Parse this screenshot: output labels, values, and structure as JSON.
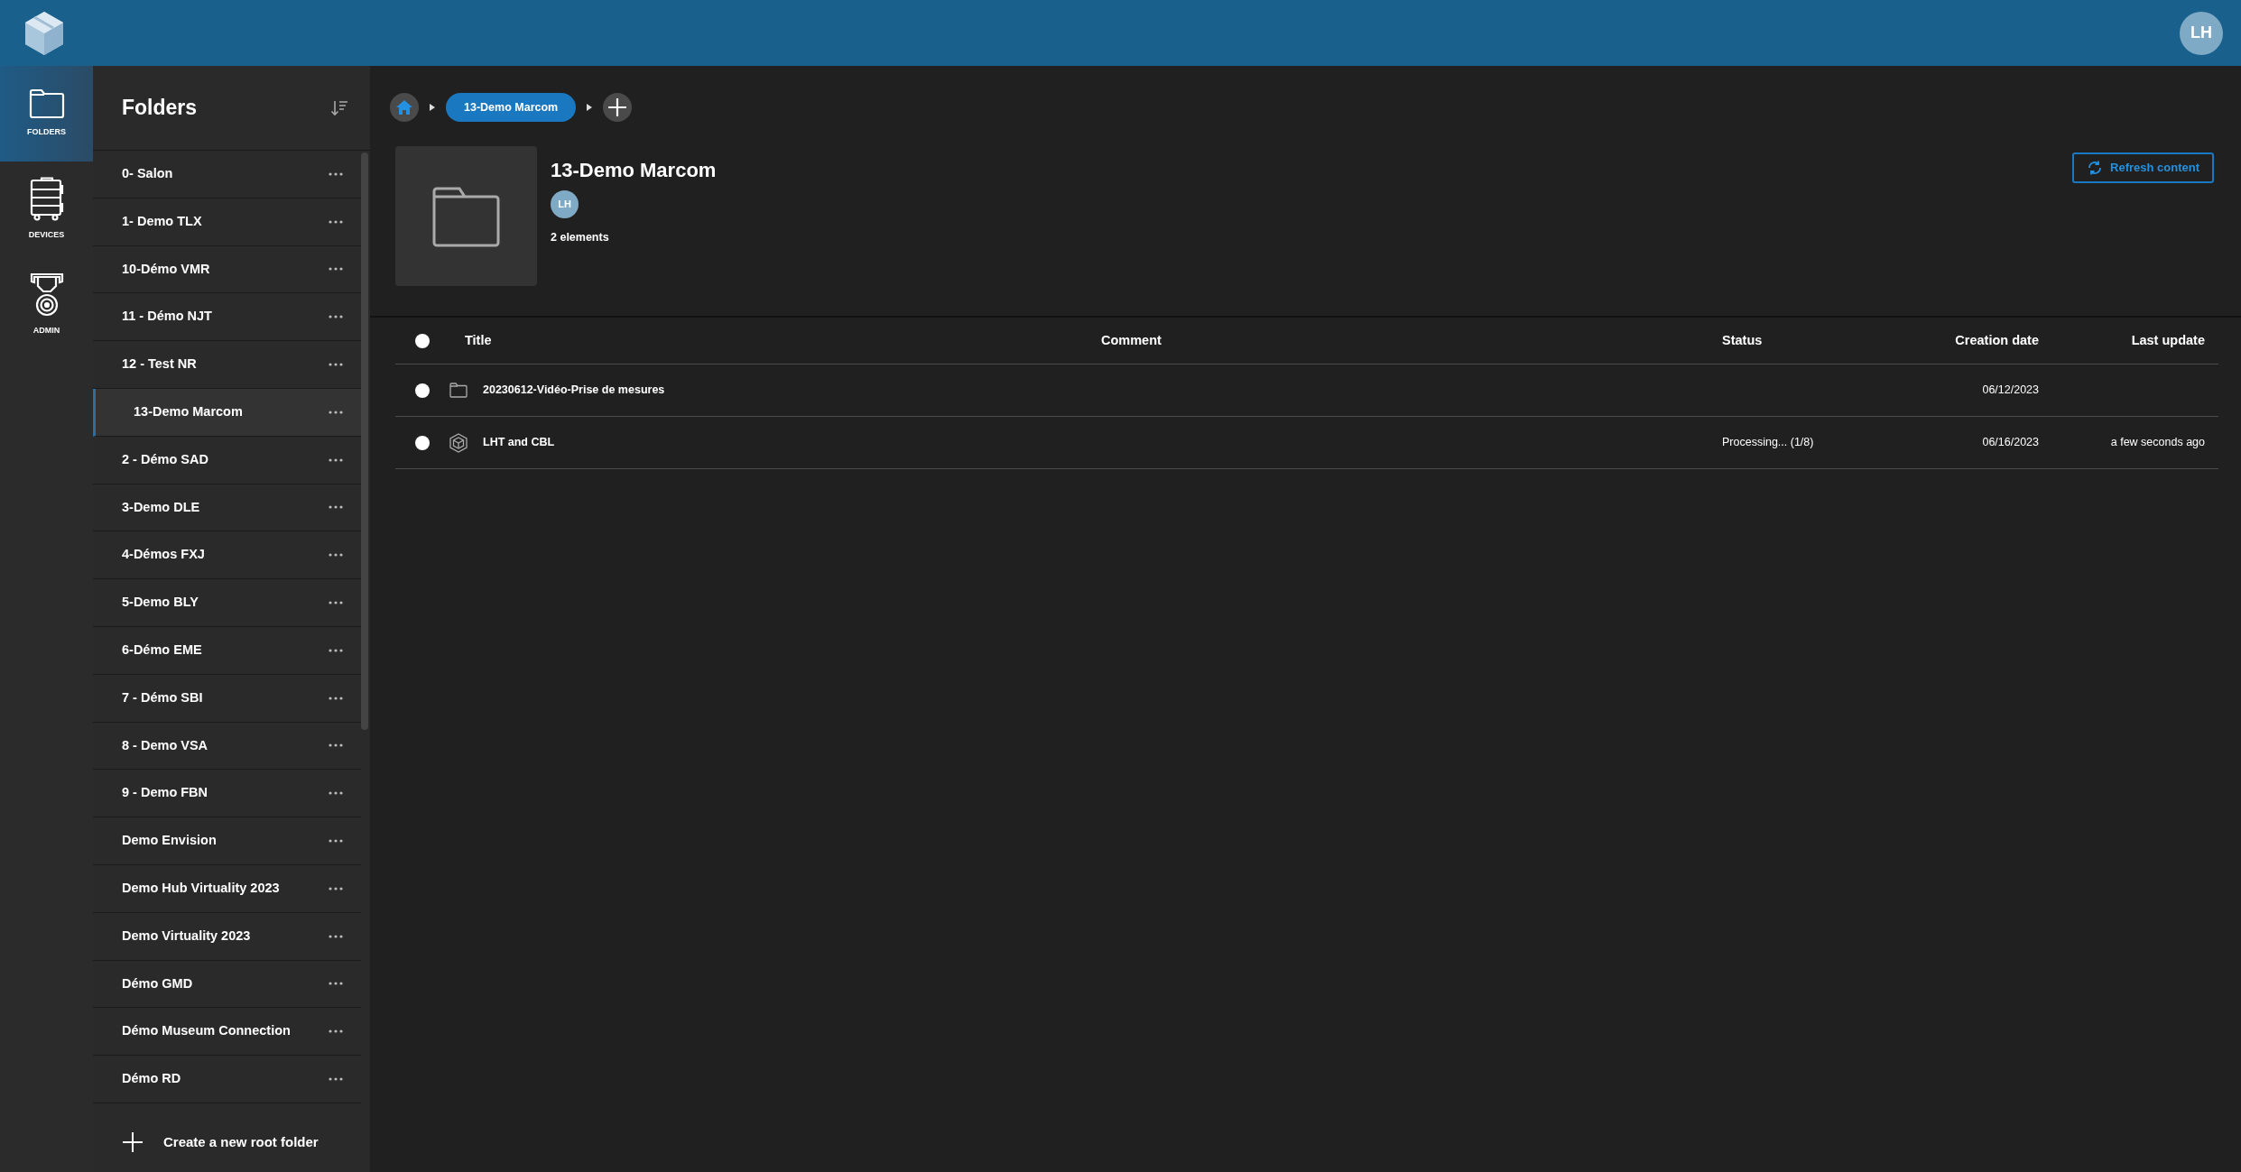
{
  "app_bar": {
    "avatar": "LH"
  },
  "nav_rail": [
    {
      "label": "FOLDERS",
      "kind": "folder",
      "selected": true
    },
    {
      "label": "DEVICES",
      "kind": "device",
      "selected": false
    },
    {
      "label": "ADMIN",
      "kind": "medal",
      "selected": false
    }
  ],
  "folders_panel": {
    "title": "Folders",
    "items": [
      {
        "label": "0- Salon",
        "selected": false
      },
      {
        "label": "1- Demo TLX",
        "selected": false
      },
      {
        "label": "10-Démo VMR",
        "selected": false
      },
      {
        "label": "11 - Démo NJT",
        "selected": false
      },
      {
        "label": "12 - Test NR",
        "selected": false
      },
      {
        "label": "13-Demo Marcom",
        "selected": true
      },
      {
        "label": "2 - Démo SAD",
        "selected": false
      },
      {
        "label": "3-Demo DLE",
        "selected": false
      },
      {
        "label": "4-Démos FXJ",
        "selected": false
      },
      {
        "label": "5-Demo BLY",
        "selected": false
      },
      {
        "label": "6-Démo EME",
        "selected": false
      },
      {
        "label": "7 - Démo SBI",
        "selected": false
      },
      {
        "label": "8 - Demo VSA",
        "selected": false
      },
      {
        "label": "9 - Demo FBN",
        "selected": false
      },
      {
        "label": "Demo Envision",
        "selected": false
      },
      {
        "label": "Demo Hub Virtuality 2023",
        "selected": false
      },
      {
        "label": "Demo Virtuality 2023",
        "selected": false
      },
      {
        "label": "Démo GMD",
        "selected": false
      },
      {
        "label": "Démo Museum Connection",
        "selected": false
      },
      {
        "label": "Démo RD",
        "selected": false
      }
    ],
    "create_button": "Create a new root folder"
  },
  "breadcrumb": [
    {
      "label": "13-Demo Marcom"
    }
  ],
  "folder": {
    "title": "13-Demo Marcom",
    "owner": "LH",
    "count": "2 elements",
    "refresh_button": "Refresh content"
  },
  "table": {
    "select_all": {
      "selected": false
    },
    "columns": [
      "Title",
      "Comment",
      "Status",
      "Creation date",
      "Last update"
    ],
    "rows": [
      {
        "kind": "folder",
        "selected": false,
        "title": "20230612-Vidéo-Prise de mesures",
        "creation_date": "06/12/2023"
      },
      {
        "kind": "model",
        "selected": false,
        "title": "LHT and CBL",
        "status": "Processing... (1/8)",
        "creation_date": "06/16/2023",
        "last_update": "a few seconds ago"
      }
    ]
  }
}
